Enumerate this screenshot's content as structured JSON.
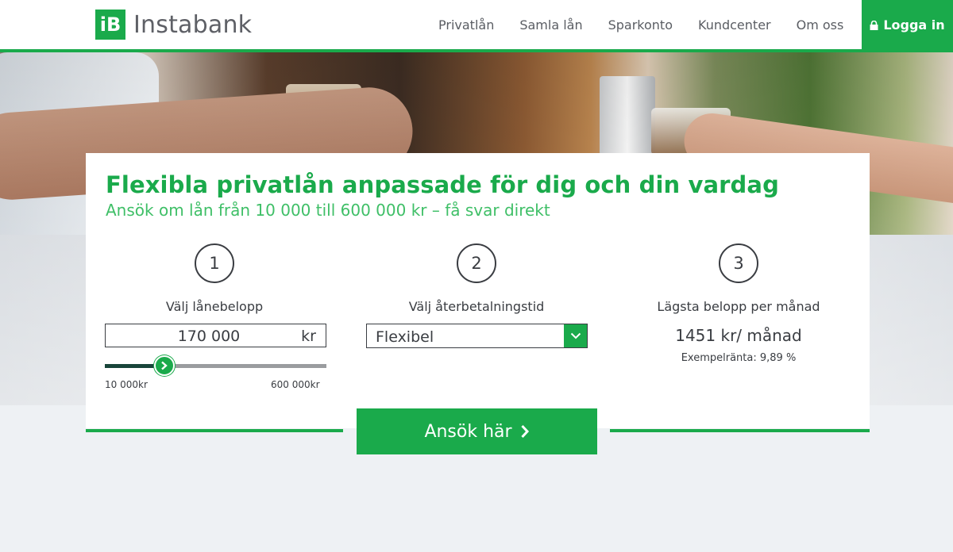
{
  "brand": {
    "logo_letter": "iB",
    "name": "Instabank"
  },
  "nav": {
    "items": [
      {
        "label": "Privatlån"
      },
      {
        "label": "Samla lån"
      },
      {
        "label": "Sparkonto"
      },
      {
        "label": "Kundcenter"
      },
      {
        "label": "Om oss"
      }
    ],
    "login_label": "Logga in"
  },
  "hero": {
    "title": "Flexibla privatlån anpassade för dig och din vardag",
    "subtitle": "Ansök om lån från 10 000 till 600 000 kr – få svar direkt"
  },
  "steps": [
    {
      "number": "1",
      "label": "Välj lånebelopp"
    },
    {
      "number": "2",
      "label": "Välj återbetalningstid"
    },
    {
      "number": "3",
      "label": "Lägsta belopp per månad"
    }
  ],
  "loan": {
    "amount": "170 000",
    "unit": "kr",
    "slider_min_label": "10 000kr",
    "slider_max_label": "600 000kr",
    "slider_fraction": 0.27
  },
  "term": {
    "selected": "Flexibel"
  },
  "result": {
    "monthly": "1451 kr/ månad",
    "rate": "Exempelränta: 9,89 %"
  },
  "cta": {
    "label": "Ansök här"
  },
  "colors": {
    "brand": "#1aaa4b",
    "slider_fill": "#18453a",
    "text": "#3a3d42"
  }
}
